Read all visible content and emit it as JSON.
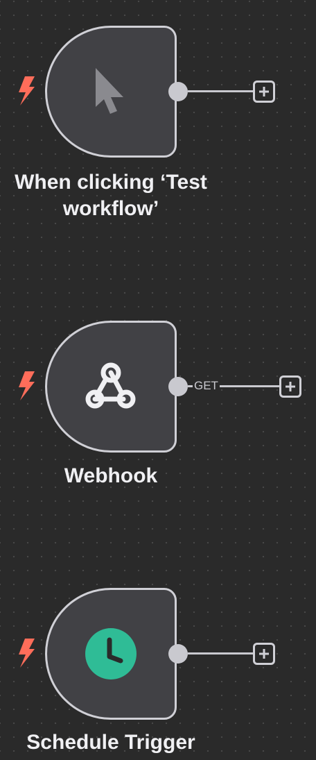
{
  "canvas": {
    "background_color": "#2a2a2a",
    "dot_color": "#4a4a4a"
  },
  "nodes": [
    {
      "title_line1": "When clicking ‘Test",
      "title_line2": "workflow’",
      "icon": "cursor-pointer-icon",
      "trigger_icon": "lightning-bolt-icon",
      "connection_label": ""
    },
    {
      "title_line1": "Webhook",
      "icon": "webhook-icon",
      "trigger_icon": "lightning-bolt-icon",
      "connection_label": "GET"
    },
    {
      "title_line1": "Schedule Trigger",
      "icon": "clock-icon",
      "trigger_icon": "lightning-bolt-icon",
      "connection_label": ""
    }
  ],
  "colors": {
    "trigger_bolt": "#ff6d5a",
    "node_fill": "#414145",
    "node_border": "#d0d0d6",
    "schedule_icon_green": "#2fbc96",
    "cursor_icon_gray": "#8a8a8f"
  }
}
